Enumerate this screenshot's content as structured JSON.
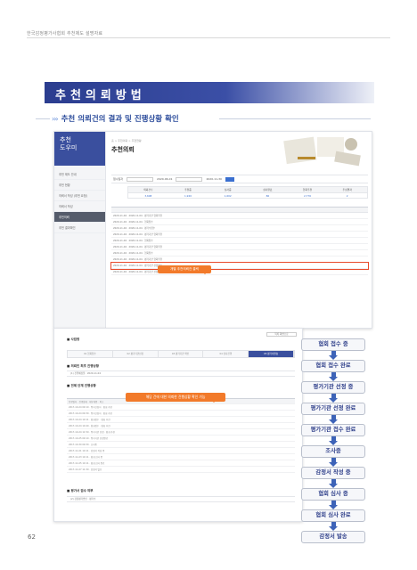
{
  "header": {
    "running_text": "한국감정평가사협회 추천제도 설명자료"
  },
  "banner": {
    "title": "추천의뢰방법"
  },
  "section": {
    "arrows": "›››",
    "title": "추천 의뢰건의 결과 및 진행상황 확인"
  },
  "shot1": {
    "logo_line1": "추천",
    "logo_line2": "도우미",
    "menu": [
      "추천 제도 안내",
      "추천 현황",
      "의뢰서 작성 (추천 요청)",
      "의뢰서 작성",
      "추천의뢰",
      "추천 결과확인"
    ],
    "breadcrumb": "홈 > 추천의뢰 > 추천현황",
    "title": "추천의뢰",
    "filter_label": "접수일자",
    "filter_from": "2020-06-01",
    "filter_to": "2020-11-30",
    "stat_headers": [
      "의뢰건수",
      "추천중",
      "심사중",
      "심사완료",
      "협회추천",
      "추심결과"
    ],
    "stat_values": [
      "3,608",
      "1,920",
      "1,602",
      "86",
      "2,776",
      "2"
    ],
    "rows": [
      "2020-11-04 · 2020-11-04 · 평가기관 협회추천",
      "2020-11-04 · 2020-11-04 · 협회접수",
      "2020-11-04 · 2020-11-04 · 평가수접수",
      "2020-11-04 · 2020-11-04 · 평가기관 협회추천",
      "2020-11-04 · 2020-11-04 · 협회접수",
      "2020-11-04 · 2020-11-04 · 평가기관 협회추천",
      "2020-11-04 · 2020-11-04 · 협회접수",
      "2020-11-04 · 2020-11-04 · 평가기관 협회추천",
      "2020-11-04 · 2020-11-04 · 평가기관 선정완료",
      "2020-11-04 · 2020-11-04 · 평가기관 선정완료"
    ],
    "callout": "개별 추천의뢰건 클릭"
  },
  "shot2": {
    "top_button": "목록 화면으로",
    "section1": "■ 사업명",
    "section2": "■ 의뢰인 최초 진행상황",
    "section3": "■ 전체 단계 진행상황",
    "section4": "■ 평가서 접수 여부",
    "steps": [
      "01 협회접수",
      "02 평가기관선정",
      "03 평가기관 확인",
      "04 심사진행",
      "05 평가서발송"
    ],
    "line1": "(1) 진행예정일 · 2020-11-04",
    "line2": "(2) 감정평가법인 · 평가수",
    "rows": [
      "진행일자 · 진행상태 · 세부내용 · 비고",
      "2017-10-24 09:10 · 평가신청서 · 협회 추천",
      "2017-10-24 09:30 · 평가신청서 · 협회 추천",
      "2017-10-24 10:11 · 협회접수 · 협회 추천",
      "2017-10-24 10:40 · 협회접수 · 협회 추천",
      "2017-10-24 11:50 · 평가기관 선정 · 협회 추천",
      "2017-10-25 09:10 · 평가기관 선정완료",
      "2017-10-30 09:30 · 조사중",
      "2017-11-01 10:11 · 감정서 작성 중",
      "2017-11-03 10:11 · 협회 심사 중",
      "2017-11-05 10:11 · 협회 심사 완료",
      "2017-11-07 11:30 · 감정서 발송"
    ],
    "callout": "해당 건에 대한 의뢰한 진행상황 확인 가능"
  },
  "flow": [
    "협회 접수 중",
    "협회 접수 완료",
    "평가기관 선정 중",
    "평가기관 선정 완료",
    "평가기관 접수 완료",
    "조사중",
    "감정서 작성 중",
    "협회 심사 중",
    "협회 심사 완료",
    "감정서 발송"
  ],
  "page_number": "62"
}
